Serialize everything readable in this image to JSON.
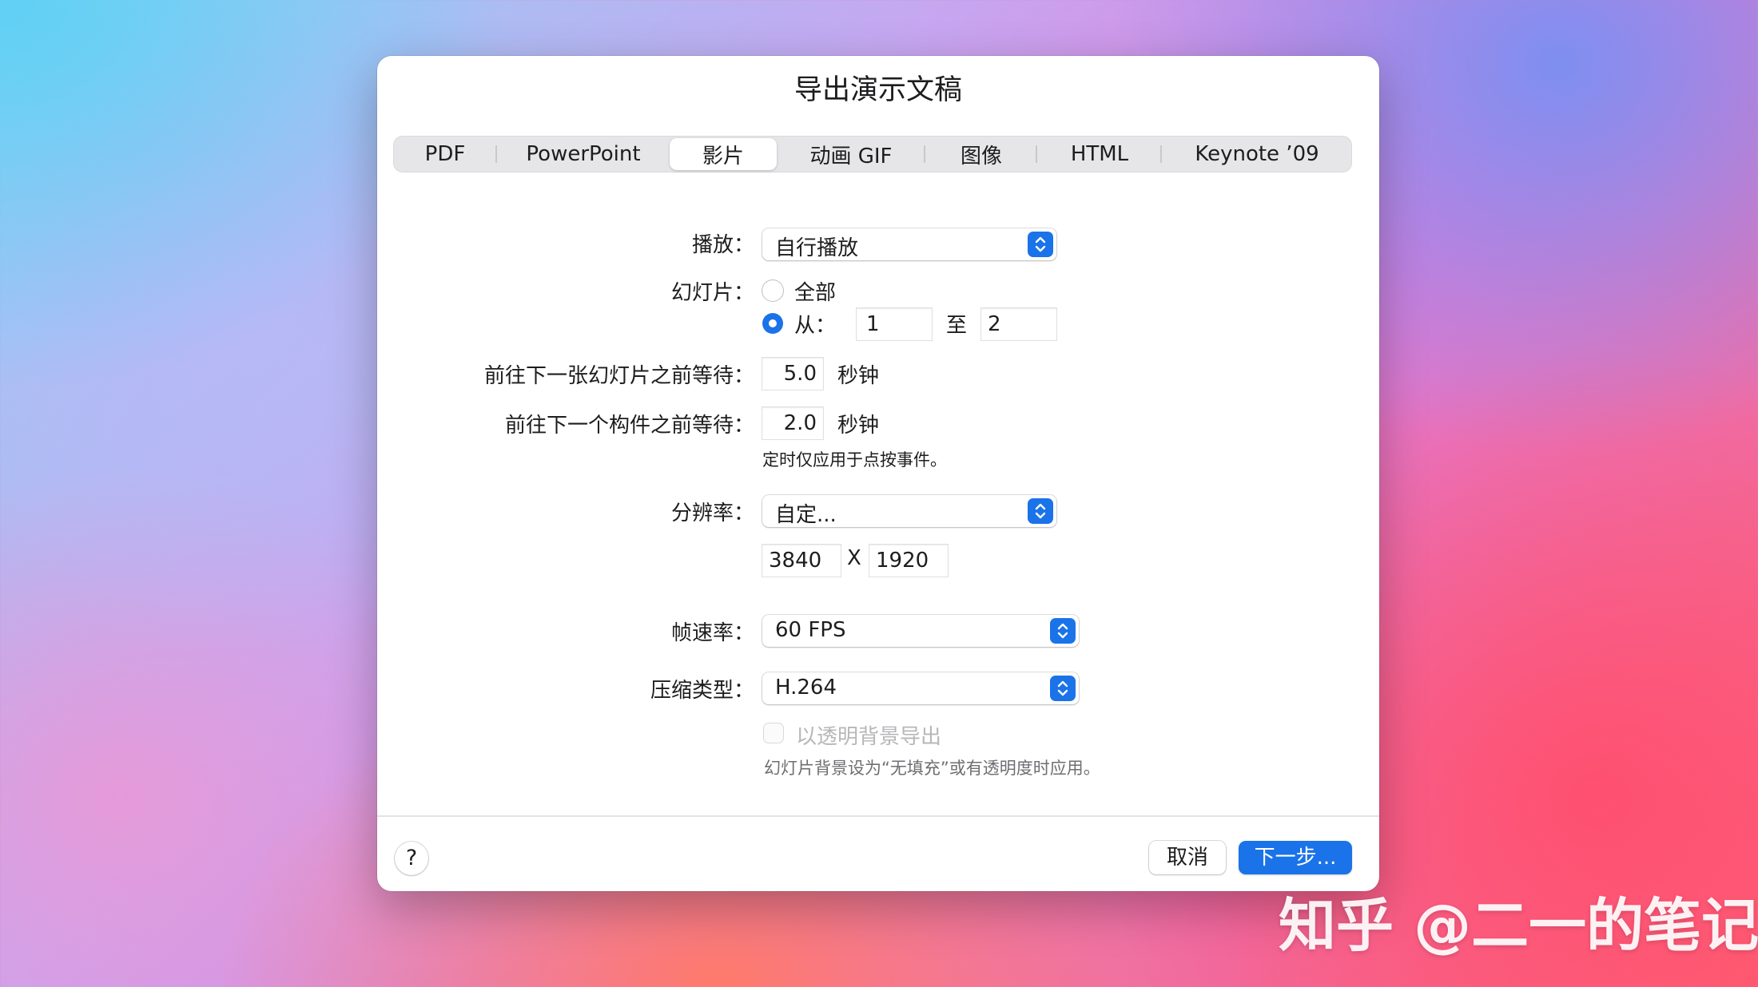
{
  "dialog": {
    "title": "导出演示文稿",
    "tabs": [
      {
        "label": "PDF"
      },
      {
        "label": "PowerPoint"
      },
      {
        "label": "影片",
        "active": true
      },
      {
        "label": "动画 GIF"
      },
      {
        "label": "图像"
      },
      {
        "label": "HTML"
      },
      {
        "label": "Keynote ’09"
      }
    ]
  },
  "form": {
    "playback": {
      "label": "播放：",
      "value": "自行播放"
    },
    "slides": {
      "label": "幻灯片：",
      "all_label": "全部",
      "all_selected": false,
      "from_label": "从：",
      "from_selected": true,
      "from_value": "1",
      "to_label": "至",
      "to_value": "2"
    },
    "slide_delay": {
      "label": "前往下一张幻灯片之前等待：",
      "value": "5.0",
      "unit": "秒钟"
    },
    "build_delay": {
      "label": "前往下一个构件之前等待：",
      "value": "2.0",
      "unit": "秒钟"
    },
    "timing_note": "定时仅应用于点按事件。",
    "resolution": {
      "label": "分辨率：",
      "value": "自定...",
      "width": "3840",
      "x_label": "X",
      "height": "1920"
    },
    "frame_rate": {
      "label": "帧速率：",
      "value": "60 FPS"
    },
    "compression": {
      "label": "压缩类型：",
      "value": "H.264"
    },
    "transparent": {
      "label": "以透明背景导出",
      "checked": false,
      "enabled": false
    },
    "transparent_note": "幻灯片背景设为“无填充”或有透明度时应用。"
  },
  "footer": {
    "help_label": "?",
    "cancel_label": "取消",
    "next_label": "下一步..."
  },
  "watermark": "知乎 @二一的笔记",
  "colors": {
    "accent": "#1a73e8"
  }
}
